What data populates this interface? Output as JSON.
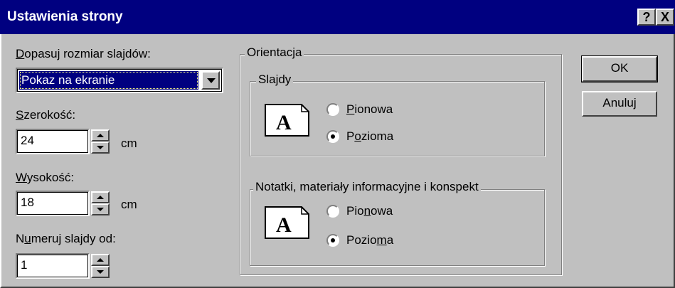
{
  "window": {
    "title": "Ustawienia strony",
    "help_label": "?",
    "close_label": "X"
  },
  "size": {
    "label_first": "D",
    "label_rest": "opasuj rozmiar slajdów:",
    "selected": "Pokaz na ekranie"
  },
  "width": {
    "label_first": "S",
    "label_rest": "zerokość:",
    "value": "24",
    "unit": "cm"
  },
  "height": {
    "label_first": "W",
    "label_rest": "ysokość:",
    "value": "18",
    "unit": "cm"
  },
  "numbering": {
    "label_pre": "N",
    "label_u": "u",
    "label_rest": "meruj slajdy od:",
    "value": "1"
  },
  "orientation": {
    "title": "Orientacja",
    "slides": {
      "title": "Slajdy",
      "portrait_u": "P",
      "portrait_rest": "ionowa",
      "landscape_pre": "P",
      "landscape_u": "o",
      "landscape_rest": "zioma",
      "selected": "landscape"
    },
    "notes": {
      "title": "Notatki, materiały informacyjne i konspekt",
      "portrait_pre": "Pio",
      "portrait_u": "n",
      "portrait_rest": "owa",
      "landscape_pre": "Pozio",
      "landscape_u": "m",
      "landscape_rest": "a",
      "selected": "landscape"
    }
  },
  "buttons": {
    "ok": "OK",
    "cancel": "Anuluj"
  }
}
